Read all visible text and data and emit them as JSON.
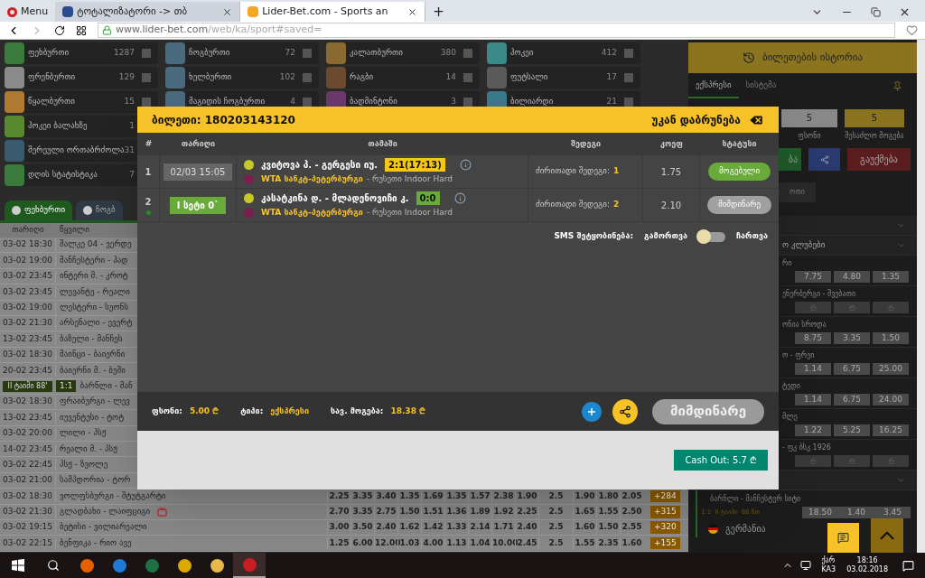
{
  "browser": {
    "menu": "Menu",
    "tabs": [
      {
        "label": "ტოტალიზატორი -> თბ",
        "selected": false
      },
      {
        "label": "Lider-Bet.com - Sports an",
        "selected": true
      }
    ],
    "new_tab": "+",
    "url_host": "www.lider-bet.com",
    "url_path": "/web/ka/sport#saved="
  },
  "sports": [
    [
      {
        "name": "ფეხბურთი",
        "count": "1287",
        "color": "#3a7a3a",
        "checked": false
      },
      {
        "name": "ფრენბურთი",
        "count": "129",
        "color": "#8a8a8a",
        "checked": false
      },
      {
        "name": "წყალბურთი",
        "count": "15",
        "color": "#b07a30",
        "checked": false
      },
      {
        "name": "ჰოკეი ბალახზე",
        "count": "1",
        "color": "#5a8a30"
      },
      {
        "name": "შერეული ორთაბრძოლა",
        "count": "31",
        "color": "#3a5a70"
      },
      {
        "name": "დღის სტატისტიკა",
        "count": "7",
        "color": "#3a7a3a"
      }
    ],
    [
      {
        "name": "ჩოგბურთი",
        "count": "72",
        "color": "#4a6a80",
        "checked": false
      },
      {
        "name": "ხელბურთი",
        "count": "102",
        "color": "#4a6a80",
        "checked": false
      },
      {
        "name": "მაგიდის ჩოგბურთი",
        "count": "4",
        "color": "#4a6a80",
        "checked": false
      }
    ],
    [
      {
        "name": "კალათბურთი",
        "count": "380",
        "color": "#8a6a30",
        "checked": false
      },
      {
        "name": "რაგბი",
        "count": "14",
        "color": "#6a4a30",
        "checked": false
      },
      {
        "name": "ბადმინტონი",
        "count": "3",
        "color": "#6a3a6a",
        "checked": false
      }
    ],
    [
      {
        "name": "ჰოკეი",
        "count": "412",
        "color": "#3a8a8a",
        "checked": false
      },
      {
        "name": "ფუტსალი",
        "count": "17",
        "color": "#5a5a5a",
        "checked": false
      },
      {
        "name": "ბილიარდი",
        "count": "21",
        "color": "#3a7a8a",
        "checked": false
      }
    ]
  ],
  "sport_tabs": [
    {
      "label": "ფეხბურთი",
      "selected": true
    },
    {
      "label": "ჩოგბ",
      "selected": false
    }
  ],
  "events": {
    "columns": [
      "თარიღი",
      "წყვილი"
    ],
    "rows": [
      {
        "kind": "scheduled",
        "date": "03-02 18:30",
        "pair": "შალკე 04 - ვერდე"
      },
      {
        "kind": "scheduled",
        "date": "03-02 19:00",
        "pair": "მანჩესტერი - ჰად"
      },
      {
        "kind": "scheduled",
        "date": "03-02 23:45",
        "pair": "ინტერი მ. - კროტ"
      },
      {
        "kind": "scheduled",
        "date": "03-02 23:45",
        "pair": "ლევანტე - რეალი"
      },
      {
        "kind": "scheduled",
        "date": "03-02 19:00",
        "pair": "ლესტერი - სუონს"
      },
      {
        "kind": "scheduled",
        "date": "03-02 21:30",
        "pair": "არსენალი - ევერტ"
      },
      {
        "kind": "scheduled",
        "date": "13-02 23:45",
        "pair": "ბაზელი - მანჩეს"
      },
      {
        "kind": "scheduled",
        "date": "03-02 18:30",
        "pair": "მაინცი - ბაიერნი"
      },
      {
        "kind": "scheduled",
        "date": "20-02 23:45",
        "pair": "ბაიერნი მ. - ბეში"
      },
      {
        "kind": "live",
        "period": "II ტაიმი 88'",
        "score": "1:1",
        "pair": "ბარნლი - მან"
      },
      {
        "kind": "scheduled",
        "date": "03-02 18:30",
        "pair": "ფრაიბურგი - ლევ"
      },
      {
        "kind": "scheduled",
        "date": "13-02 23:45",
        "pair": "იუვენტუსი - ტოტ"
      },
      {
        "kind": "scheduled",
        "date": "03-02 20:00",
        "pair": "ლილი - პსჟ"
      },
      {
        "kind": "scheduled",
        "date": "14-02 23:45",
        "pair": "რეალი მ. - პსჟ"
      },
      {
        "kind": "scheduled",
        "date": "03-02 22:45",
        "pair": "პსჟ - ზვოლე"
      },
      {
        "kind": "scheduled",
        "date": "03-02 21:00",
        "pair": "სამპდორია - ტორ"
      },
      {
        "kind": "full",
        "date": "03-02 18:30",
        "pair": "ვოლფსბურგი - შტუტგარტი",
        "tv": false,
        "odds": [
          "2.25",
          "3.35",
          "3.40",
          "1.35",
          "1.69",
          "1.35",
          "1.57",
          "2.38",
          "1.90",
          "2.5",
          "1.90",
          "1.80",
          "2.05"
        ],
        "more": "+284"
      },
      {
        "kind": "full",
        "date": "03-02 21:30",
        "pair": "გლადბახი - ლაიფციგი",
        "tv": true,
        "odds": [
          "2.70",
          "3.35",
          "2.75",
          "1.50",
          "1.51",
          "1.36",
          "1.89",
          "1.92",
          "2.25",
          "2.5",
          "1.65",
          "1.55",
          "2.50"
        ],
        "more": "+315"
      },
      {
        "kind": "full",
        "date": "03-02 19:15",
        "pair": "ბეტისი - ვილიარეალი",
        "tv": false,
        "odds": [
          "3.00",
          "3.50",
          "2.40",
          "1.62",
          "1.42",
          "1.33",
          "2.14",
          "1.71",
          "2.40",
          "2.5",
          "1.60",
          "1.50",
          "2.55"
        ],
        "more": "+320"
      },
      {
        "kind": "full",
        "date": "03-02 22:15",
        "pair": "ბენფიკა - რიო ავე",
        "tv": false,
        "odds": [
          "1.25",
          "6.00",
          "12.00",
          "1.03",
          "4.00",
          "1.13",
          "1.04",
          "10.00",
          "2.45",
          "2.5",
          "1.55",
          "2.35",
          "1.60"
        ],
        "more": "+155"
      }
    ]
  },
  "sidebar": {
    "history": "ბილეთების ისტორია",
    "tabs": [
      {
        "label": "ექსპრესი",
        "selected": true
      },
      {
        "label": "სისტემა",
        "selected": false
      }
    ],
    "stake": {
      "value": "5",
      "label": "ფსონი"
    },
    "win": {
      "value": "5",
      "label": "შესაძლო მოგება"
    },
    "place_fragment": "ბა",
    "cancel": "გაუქმება",
    "tab_fragment": "ოთი",
    "items": [
      {
        "kind": "section"
      },
      {
        "kind": "section",
        "label": "ო კლუბები"
      },
      {
        "kind": "match",
        "name": "რი",
        "locked": false,
        "odds": [
          "7.75",
          "4.80",
          "1.35"
        ]
      },
      {
        "kind": "match",
        "name": "ენერბერგი - შვებათი",
        "locked": true
      },
      {
        "kind": "match",
        "name": "ონია სროდა",
        "locked": false,
        "odds": [
          "8.75",
          "3.35",
          "1.50"
        ]
      },
      {
        "kind": "match",
        "name": "ო - ფრეი",
        "locked": false,
        "odds": [
          "1.14",
          "6.75",
          "25.00"
        ]
      },
      {
        "kind": "match",
        "name": "ტედი",
        "locked": false,
        "odds": [
          "1.14",
          "6.75",
          "24.00"
        ]
      },
      {
        "kind": "match",
        "name": "მლე",
        "locked": false,
        "odds": [
          "1.22",
          "5.25",
          "16.25"
        ]
      },
      {
        "kind": "match",
        "name": "- ფკ ბსკ 1926",
        "locked": true
      },
      {
        "kind": "section"
      },
      {
        "kind": "live",
        "name": "ბარნლი - მანჩესტერ სიტი",
        "score": "1:1",
        "period": "II ტაიმი",
        "minute": "86 წთ",
        "odds": [
          "18.50",
          "1.40",
          "3.45"
        ]
      },
      {
        "kind": "country",
        "label": "გერმანია"
      }
    ]
  },
  "modal": {
    "title": "ბილეთი: 180203143120",
    "back": "უკან დაბრუნება",
    "columns": [
      "#",
      "თარიღი",
      "თამაში",
      "შედეგი",
      "კოეფ",
      "სტატუსი"
    ],
    "rows": [
      {
        "num": "1",
        "live": false,
        "date": "02/03 15:05",
        "game": "კვიტოვა პ. - გერგესი იუ.",
        "score": {
          "text": "2:1(17:13)",
          "color": "#f5c518"
        },
        "tournament": "WTA სანკტ-პეტერბურგი",
        "location": "- რუსეთი Indoor Hard",
        "result_label": "ძირითადი შედეგი:",
        "pick": "1",
        "odd": "1.75",
        "status": {
          "text": "მოგებული",
          "color": "#6aaa3a"
        }
      },
      {
        "num": "2",
        "live": true,
        "date": "I სეტი 0`",
        "game": "კასატკინა დ. - მლადენოვიჩი კ.",
        "score": {
          "text": "0:0",
          "color": "#6aaa3a"
        },
        "tournament": "WTA სანკტ-პეტერბურგი",
        "location": "- რუსეთი Indoor Hard",
        "result_label": "ძირითადი შედეგი:",
        "pick": "2",
        "odd": "2.10",
        "status": {
          "text": "მიმდინარე",
          "color": "#a0a0a0"
        }
      }
    ],
    "sms": {
      "label": "SMS შეტყობინება:",
      "off": "გამორთვა",
      "on_label": "ჩართვა",
      "on": false
    },
    "stake_label": "ფსონი:",
    "stake": "5.00 ₾",
    "type_label": "ტიპი:",
    "type": "ექსპრესი",
    "win_label": "სავ. მოგება:",
    "win": "18.38 ₾",
    "state_button": "მიმდინარე",
    "cashout": "Cash Out: 5.7 ₾"
  },
  "taskbar": {
    "lang1": "ქარ",
    "lang2": "KA3",
    "time": "18:16",
    "date": "03.02.2018"
  }
}
